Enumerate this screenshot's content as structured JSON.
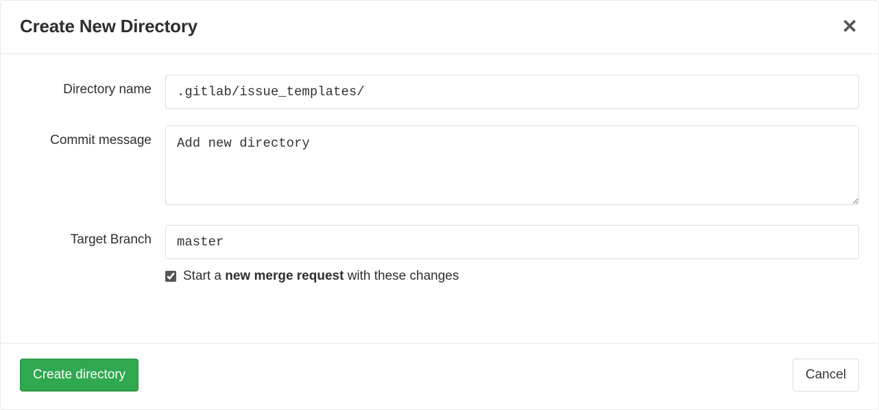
{
  "modal": {
    "title": "Create New Directory"
  },
  "form": {
    "directory_name": {
      "label": "Directory name",
      "value": ".gitlab/issue_templates/"
    },
    "commit_message": {
      "label": "Commit message",
      "value": "Add new directory"
    },
    "target_branch": {
      "label": "Target Branch",
      "value": "master"
    },
    "merge_request": {
      "checked": true,
      "prefix": "Start a ",
      "bold": "new merge request",
      "suffix": " with these changes"
    }
  },
  "footer": {
    "submit_label": "Create directory",
    "cancel_label": "Cancel"
  }
}
